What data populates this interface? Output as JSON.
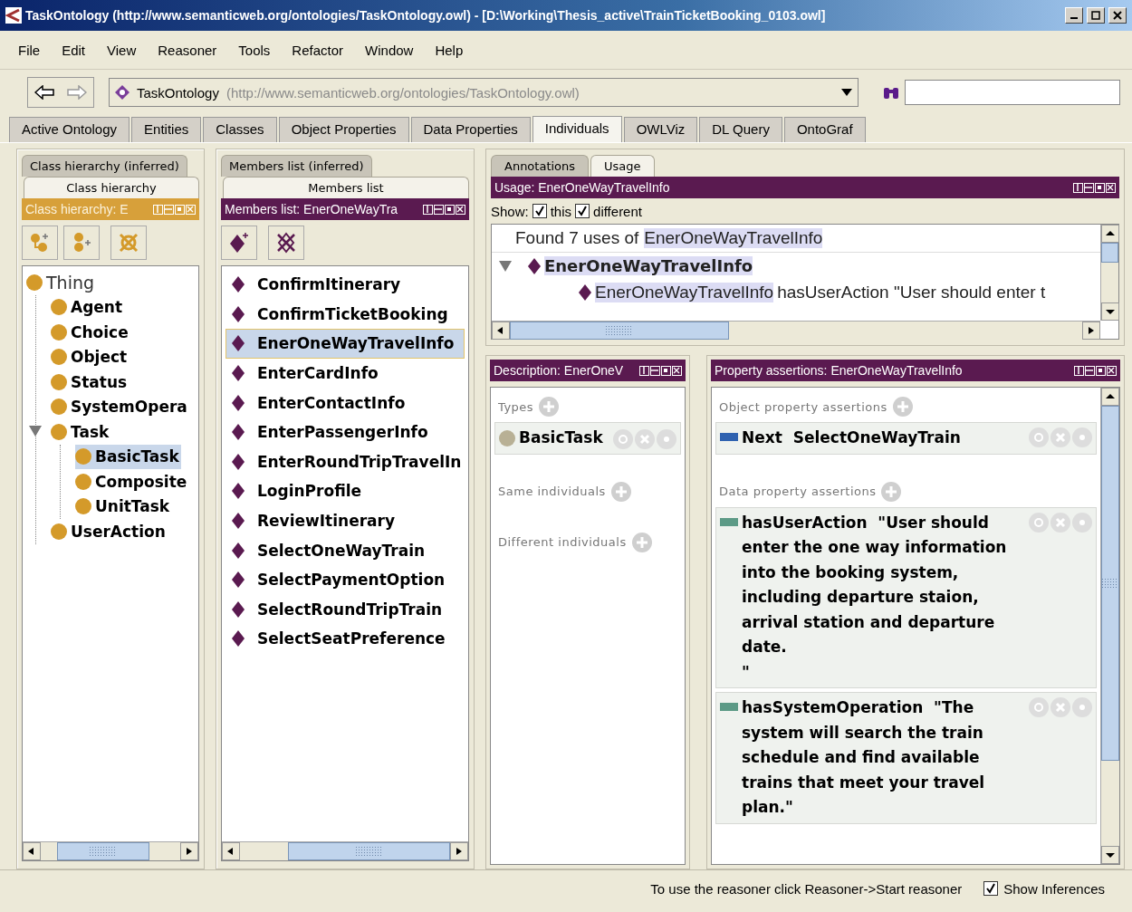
{
  "window": {
    "title": "TaskOntology (http://www.semanticweb.org/ontologies/TaskOntology.owl) - [D:\\Working\\Thesis_active\\TrainTicketBooking_0103.owl]"
  },
  "menu": [
    "File",
    "Edit",
    "View",
    "Reasoner",
    "Tools",
    "Refactor",
    "Window",
    "Help"
  ],
  "toolbar": {
    "ontology_name": "TaskOntology",
    "ontology_iri": "(http://www.semanticweb.org/ontologies/TaskOntology.owl)"
  },
  "tabs": [
    {
      "label": "Active Ontology",
      "selected": false
    },
    {
      "label": "Entities",
      "selected": false
    },
    {
      "label": "Classes",
      "selected": false
    },
    {
      "label": "Object Properties",
      "selected": false
    },
    {
      "label": "Data Properties",
      "selected": false
    },
    {
      "label": "Individuals",
      "selected": true
    },
    {
      "label": "OWLViz",
      "selected": false
    },
    {
      "label": "DL Query",
      "selected": false
    },
    {
      "label": "OntoGraf",
      "selected": false
    }
  ],
  "class_hierarchy": {
    "tabs": [
      {
        "label": "Class hierarchy (inferred)",
        "selected": false
      },
      {
        "label": "Class hierarchy",
        "selected": true
      }
    ],
    "title": "Class hierarchy: E",
    "tree": [
      {
        "label": "Thing",
        "selected": false,
        "children": [
          {
            "label": "Agent",
            "selected": false
          },
          {
            "label": "Choice",
            "selected": false
          },
          {
            "label": "Object",
            "selected": false
          },
          {
            "label": "Status",
            "selected": false
          },
          {
            "label": "SystemOpera",
            "selected": false
          },
          {
            "label": "Task",
            "selected": false,
            "children": [
              {
                "label": "BasicTask",
                "selected": true
              },
              {
                "label": "Composite",
                "selected": false
              },
              {
                "label": "UnitTask",
                "selected": false
              }
            ]
          },
          {
            "label": "UserAction",
            "selected": false
          }
        ]
      }
    ]
  },
  "members": {
    "tabs": [
      {
        "label": "Members list (inferred)",
        "selected": false
      },
      {
        "label": "Members list",
        "selected": true
      }
    ],
    "title": "Members list: EnerOneWayTra",
    "items": [
      {
        "label": "ConfirmItinerary",
        "selected": false
      },
      {
        "label": "ConfirmTicketBooking",
        "selected": false
      },
      {
        "label": "EnerOneWayTravelInfo",
        "selected": true
      },
      {
        "label": "EnterCardInfo",
        "selected": false
      },
      {
        "label": "EnterContactInfo",
        "selected": false
      },
      {
        "label": "EnterPassengerInfo",
        "selected": false
      },
      {
        "label": "EnterRoundTripTravelIn",
        "selected": false
      },
      {
        "label": "LoginProfile",
        "selected": false
      },
      {
        "label": "ReviewItinerary",
        "selected": false
      },
      {
        "label": "SelectOneWayTrain",
        "selected": false
      },
      {
        "label": "SelectPaymentOption",
        "selected": false
      },
      {
        "label": "SelectRoundTripTrain",
        "selected": false
      },
      {
        "label": "SelectSeatPreference",
        "selected": false
      }
    ]
  },
  "usage": {
    "tabs": [
      {
        "label": "Annotations",
        "selected": false
      },
      {
        "label": "Usage",
        "selected": true
      }
    ],
    "title": "Usage: EnerOneWayTravelInfo",
    "show_label": "Show:",
    "show_options": [
      {
        "label": "this",
        "checked": true
      },
      {
        "label": "different",
        "checked": true
      }
    ],
    "found_prefix": "Found 7 uses of",
    "found_subject": "EnerOneWayTravelInfo",
    "entity": "EnerOneWayTravelInfo",
    "uses": [
      {
        "subject": "EnerOneWayTravelInfo",
        "rest": "hasUserAction \"User should enter t"
      }
    ]
  },
  "description": {
    "title": "Description: EnerOneV",
    "sections": [
      {
        "label": "Types",
        "items": [
          "BasicTask"
        ]
      },
      {
        "label": "Same individuals"
      },
      {
        "label": "Different individuals"
      }
    ]
  },
  "property_assertions": {
    "title": "Property assertions: EnerOneWayTravelInfo",
    "sections": [
      {
        "label": "Object property assertions",
        "kind": "object",
        "items": [
          {
            "property": "Next",
            "value": "SelectOneWayTrain"
          }
        ]
      },
      {
        "label": "Data property assertions",
        "kind": "data",
        "items": [
          {
            "property": "hasUserAction",
            "value": "\"User should enter the one way information into the booking system, including departure staion, arrival station and departure date.\n\""
          },
          {
            "property": "hasSystemOperation",
            "value": "\"The system will search the train schedule and find available trains that meet your travel plan.\""
          }
        ]
      }
    ]
  },
  "status_bar": {
    "message": "To use the reasoner click Reasoner->Start reasoner",
    "show_inferences": {
      "label": "Show Inferences",
      "checked": true
    }
  }
}
